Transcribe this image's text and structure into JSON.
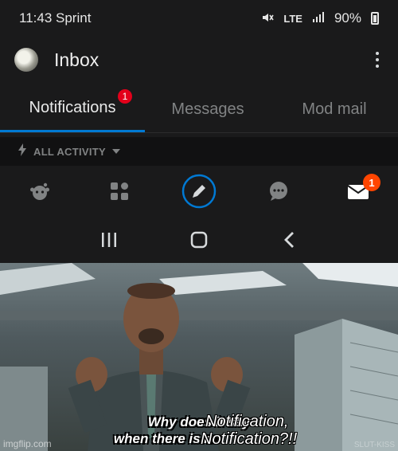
{
  "status_bar": {
    "time": "11:43",
    "carrier": "Sprint",
    "network": "LTE",
    "battery": "90%",
    "icons": [
      "mute-icon",
      "lte-icon",
      "signal-icon",
      "battery-icon"
    ]
  },
  "header": {
    "title": "Inbox",
    "menu_icon": "kebab-menu-icon"
  },
  "tabs": [
    {
      "label": "Notifications",
      "active": true,
      "badge": "1"
    },
    {
      "label": "Messages",
      "active": false
    },
    {
      "label": "Mod mail",
      "active": false
    }
  ],
  "filter": {
    "label": "ALL ACTIVITY",
    "icon": "bolt-icon"
  },
  "bottom_nav": {
    "items": [
      "home-icon",
      "communities-icon",
      "create-post-icon",
      "chat-icon",
      "inbox-mail-icon"
    ],
    "mail_badge": "1"
  },
  "system_nav": [
    "recents-icon",
    "home-button-icon",
    "back-icon"
  ],
  "meme": {
    "caption_line1_prefix": "Why does it say",
    "caption_line1_typed": "Notification,",
    "caption_line2_prefix": "when there is no",
    "caption_line2_typed": "Notification?!!",
    "watermark": "imgflip.com",
    "watermark_right": "SLUT-KISS"
  },
  "colors": {
    "accent_blue": "#0079d3",
    "badge_red": "#e3001b",
    "badge_orange": "#ff4500",
    "background": "#1a1a1b"
  }
}
